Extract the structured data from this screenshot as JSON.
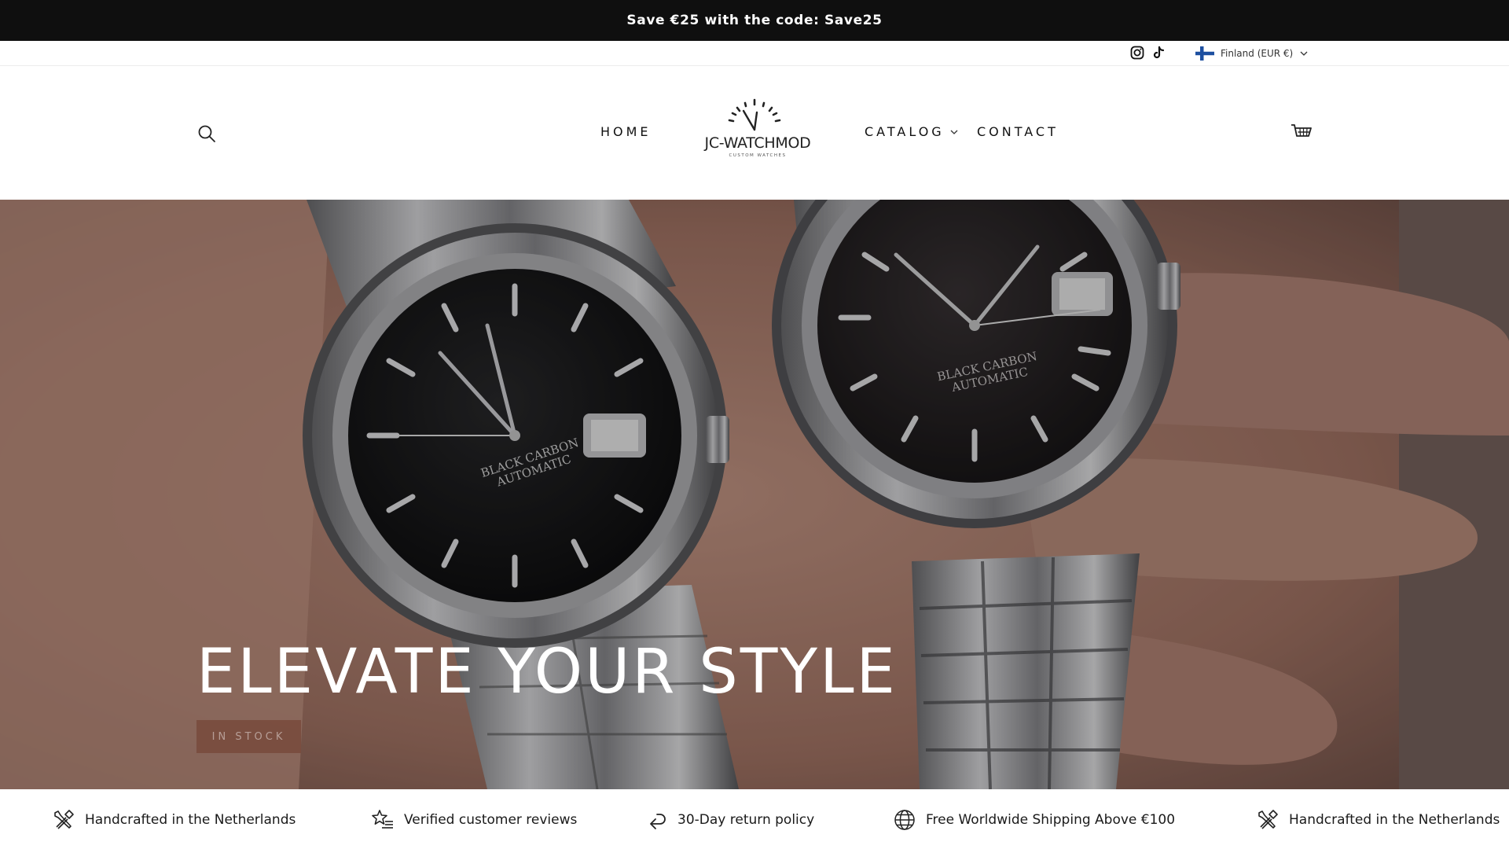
{
  "announcement": {
    "text": "Save €25 with the code: Save25"
  },
  "utility": {
    "social": [
      {
        "icon": "instagram-icon"
      },
      {
        "icon": "tiktok-icon"
      }
    ],
    "country_selector": {
      "label": "Finland (EUR €)",
      "flag": "finland-flag-icon"
    }
  },
  "header": {
    "logo": {
      "name": "JC-WATCHMOD",
      "tagline": "CUSTOM WATCHES"
    },
    "nav": [
      {
        "label": "HOME"
      },
      {
        "label": "CATALOG",
        "has_dropdown": true
      },
      {
        "label": "CONTACT"
      }
    ],
    "icons": {
      "search": "search-icon",
      "cart": "cart-icon"
    }
  },
  "hero": {
    "title": "ELEVATE YOUR STYLE",
    "button_label": "IN STOCK",
    "watch_dial_text": [
      "BLACK CARBON",
      "AUTOMATIC"
    ]
  },
  "features": [
    {
      "icon": "tools-icon",
      "label": "Handcrafted in the Netherlands"
    },
    {
      "icon": "star-list-icon",
      "label": "Verified customer reviews"
    },
    {
      "icon": "return-arrow-icon",
      "label": "30-Day return policy"
    },
    {
      "icon": "globe-icon",
      "label": "Free Worldwide Shipping Above €100"
    },
    {
      "icon": "tools-icon",
      "label": "Handcrafted in the Netherlands"
    }
  ],
  "colors": {
    "announcement_bg": "#0f0f0f",
    "hero_button_bg": "#784a3c",
    "text": "#111111"
  }
}
